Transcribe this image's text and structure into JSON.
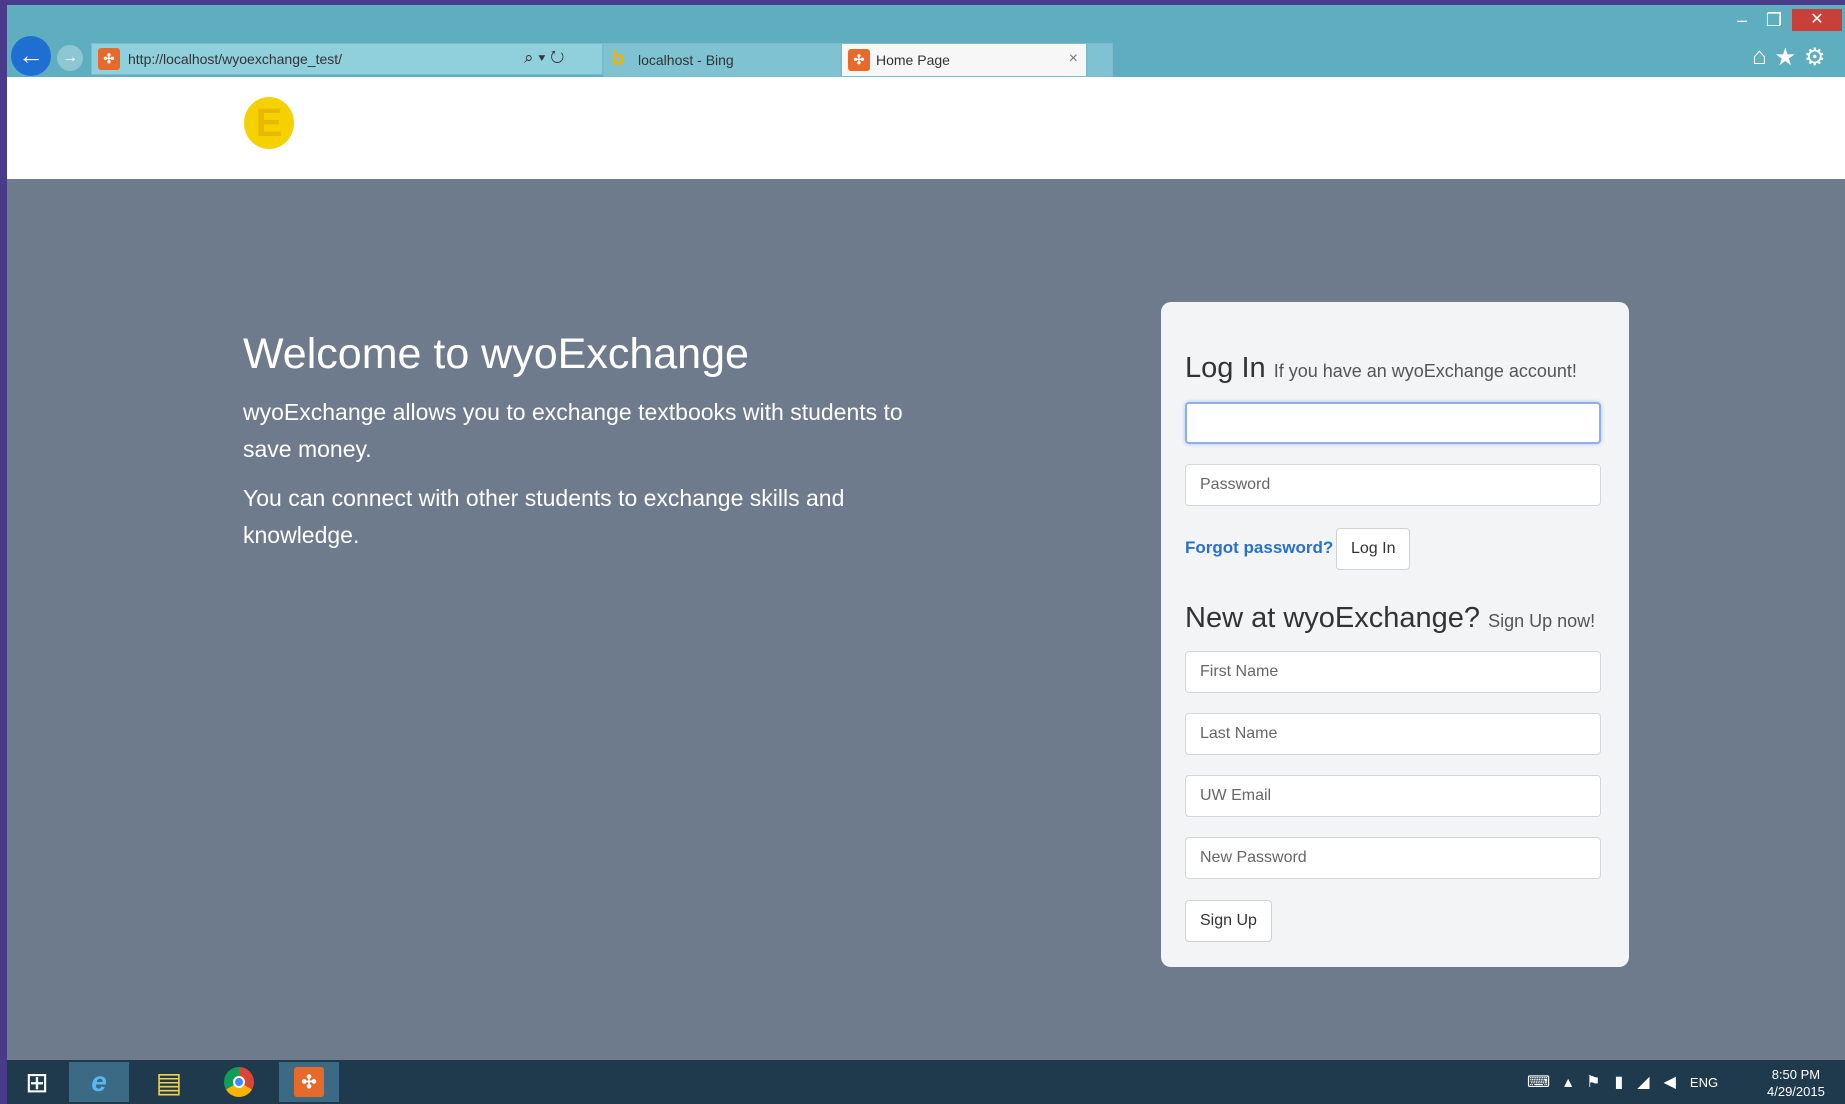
{
  "browser": {
    "window_controls": {
      "minimize": "–",
      "maximize": "❐",
      "close": "✕"
    },
    "back_icon": "←",
    "forward_icon": "→",
    "address": {
      "url": "http://localhost/wyoexchange_test/",
      "search_icon": "⌕",
      "dropdown_icon": "▾",
      "refresh_icon": "↻"
    },
    "tabs": [
      {
        "label": "localhost - Bing",
        "active": false
      },
      {
        "label": "Home Page",
        "active": true,
        "close": "×"
      }
    ],
    "toolbar_icons": {
      "home": "⌂",
      "favorites": "★",
      "settings": "⚙"
    }
  },
  "site": {
    "logo_letter": "E",
    "hero": {
      "title": "Welcome to wyoExchange",
      "paragraph1": "wyoExchange allows you to exchange textbooks with students to save money.",
      "paragraph2": "You can connect with other students to exchange skills and knowledge."
    },
    "login": {
      "heading": "Log In",
      "subheading": "If you have an wyoExchange account!",
      "username_value": "",
      "password_placeholder": "Password",
      "forgot_link": "Forgot password?",
      "submit_label": "Log In"
    },
    "signup": {
      "heading": "New at wyoExchange?",
      "subheading": "Sign Up now!",
      "first_name_placeholder": "First Name",
      "last_name_placeholder": "Last Name",
      "email_placeholder": "UW Email",
      "new_password_placeholder": "New Password",
      "submit_label": "Sign Up"
    }
  },
  "taskbar": {
    "tray_language": "ENG",
    "clock_time": "8:50 PM",
    "clock_date": "4/29/2015"
  },
  "colors": {
    "page_background": "#6e7b8c",
    "chrome_bar": "#5faec0",
    "link_blue": "#2a6fc9",
    "logo_yellow": "#f6d100"
  }
}
